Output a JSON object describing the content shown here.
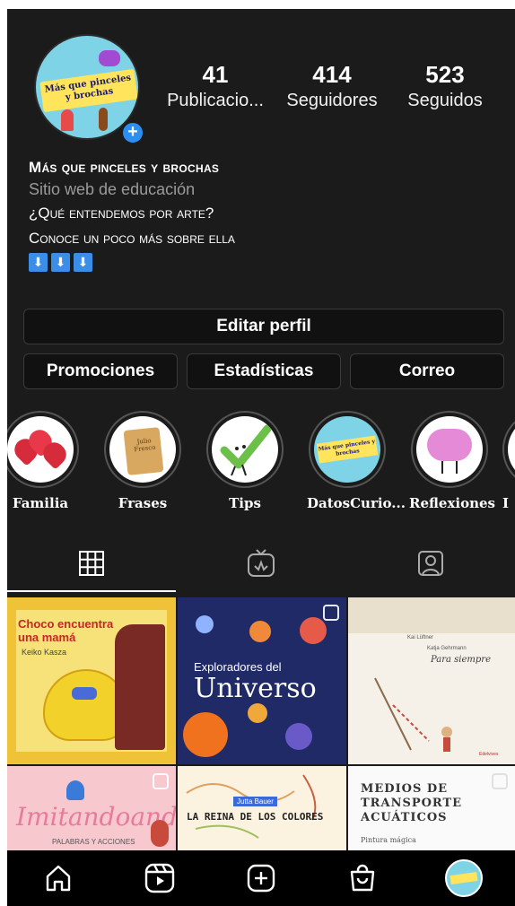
{
  "profile": {
    "stats": [
      {
        "value": "41",
        "label": "Publicacio..."
      },
      {
        "value": "414",
        "label": "Seguidores"
      },
      {
        "value": "523",
        "label": "Seguidos"
      }
    ],
    "avatar_text": "Más que pinceles y brochas",
    "name": "Más que pinceles y brochas",
    "category": "Sitio web de educación",
    "bio_lines": [
      "¿Qué entendemos por arte?",
      "Conoce un poco más sobre ella"
    ],
    "bio_arrows": [
      "⬇",
      "⬇",
      "⬇"
    ]
  },
  "buttons": {
    "edit_profile": "Editar perfil",
    "promotions": "Promociones",
    "statistics": "Estadísticas",
    "email": "Correo"
  },
  "highlights": [
    {
      "label": "Familia"
    },
    {
      "label": "Frases",
      "image_text": "Julio Fresco"
    },
    {
      "label": "Tips"
    },
    {
      "label": "DatosCurio...",
      "image_text": "Más que pinceles y brochas"
    },
    {
      "label": "Reflexiones"
    },
    {
      "label": "I"
    }
  ],
  "tabs": [
    "grid-icon",
    "igtv-icon",
    "tagged-icon"
  ],
  "posts": [
    {
      "title": "Choco encuentra una mamá",
      "subtitle": "Keiko Kasza"
    },
    {
      "title": "Exploradores del",
      "title2": "Universo"
    },
    {
      "author": "Kai Lüftner",
      "author2": "Katja Gehrmann",
      "title": "Para siempre",
      "publisher": "Edelvives"
    },
    {
      "title": "Imitandoando",
      "subtitle": "PALABRAS Y ACCIONES"
    },
    {
      "author": "Jutta Bauer",
      "title": "LA REINA DE LOS COLORES"
    },
    {
      "title": "MEDIOS DE TRANSPORTE ACUÁTICOS",
      "subtitle": "Pintura mágica"
    }
  ],
  "bottom_nav": [
    "home-icon",
    "reels-icon",
    "create-icon",
    "shop-icon",
    "profile-avatar"
  ],
  "colors": {
    "background": "#1b1b1b",
    "accent_blue": "#2b8ef0",
    "avatar_bg": "#7fd3e6",
    "avatar_banner": "#ffe45c"
  }
}
